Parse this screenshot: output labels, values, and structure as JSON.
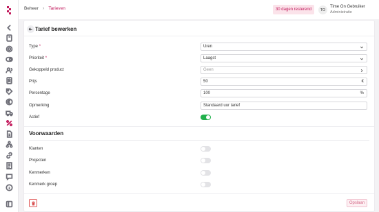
{
  "header": {
    "breadcrumb": [
      {
        "label": "Beheer"
      },
      {
        "label": "Tarieven"
      }
    ],
    "trial_badge": "30 dagen resterend",
    "user": {
      "initials": "TO",
      "name": "Time On Gebruiker",
      "role": "Administratie"
    }
  },
  "sidebar": {
    "icons": [
      "chevron-left-icon",
      "book-icon",
      "gear-icon",
      "toggle-icon",
      "users-icon",
      "contacts-icon",
      "tag-icon",
      "euro-icon",
      "truck-icon",
      "percent-icon",
      "document-icon",
      "sitemap-icon",
      "link-icon",
      "chat-icon",
      "ledger-icon",
      "info-icon",
      "collapse-icon"
    ],
    "active": "percent-icon",
    "accent_color": "#c2185b"
  },
  "form": {
    "title": "Tarief bewerken",
    "fields": {
      "type": {
        "label": "Type",
        "required": "*",
        "value": "Uren"
      },
      "priority": {
        "label": "Prioriteit",
        "required": "*",
        "value": "Laagst"
      },
      "linked_product": {
        "label": "Gekoppeld product",
        "placeholder": "Geen"
      },
      "price": {
        "label": "Prijs",
        "value": "50",
        "suffix": "€"
      },
      "percentage": {
        "label": "Percentage",
        "value": "100",
        "suffix": "%"
      },
      "remark": {
        "label": "Opmerking",
        "value": "Standaard uur tarief"
      },
      "active": {
        "label": "Actief",
        "on": true
      }
    },
    "conditions": {
      "title": "Voorwaarden",
      "items": [
        {
          "label": "Klanten",
          "on": false
        },
        {
          "label": "Projecten",
          "on": false
        },
        {
          "label": "Kenmerken",
          "on": false
        },
        {
          "label": "Kenmerk groep",
          "on": false
        }
      ]
    },
    "save_label": "Opslaan"
  }
}
